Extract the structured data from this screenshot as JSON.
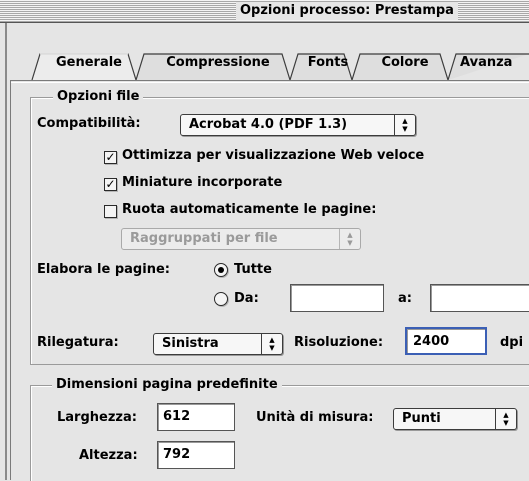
{
  "window": {
    "title": "Opzioni processo: Prestampa"
  },
  "tabs": [
    {
      "label": "Generale",
      "active": true
    },
    {
      "label": "Compressione",
      "active": false
    },
    {
      "label": "Fonts",
      "active": false
    },
    {
      "label": "Colore",
      "active": false
    },
    {
      "label": "Avanza",
      "active": false
    }
  ],
  "file_options": {
    "group_title": "Opzioni file",
    "compat_label": "Compatibilità:",
    "compat_value": "Acrobat 4.0 (PDF 1.3)",
    "optimize_label": "Ottimizza per visualizzazione Web veloce",
    "optimize_checked": true,
    "thumbnails_label": "Miniature incorporate",
    "thumbnails_checked": true,
    "autorotate_label": "Ruota automaticamente le pagine:",
    "autorotate_checked": false,
    "autorotate_mode": "Raggruppati per file",
    "pages_label": "Elabora le pagine:",
    "all_label": "Tutte",
    "from_label": "Da:",
    "to_label": "a:",
    "from_value": "",
    "to_value": "",
    "pages_all_selected": true,
    "binding_label": "Rilegatura:",
    "binding_value": "Sinistra",
    "resolution_label": "Risoluzione:",
    "resolution_value": "2400",
    "resolution_unit": "dpi"
  },
  "default_page_size": {
    "group_title": "Dimensioni pagina predefinite",
    "width_label": "Larghezza:",
    "width_value": "612",
    "height_label": "Altezza:",
    "height_value": "792",
    "units_label": "Unità di misura:",
    "units_value": "Punti"
  }
}
